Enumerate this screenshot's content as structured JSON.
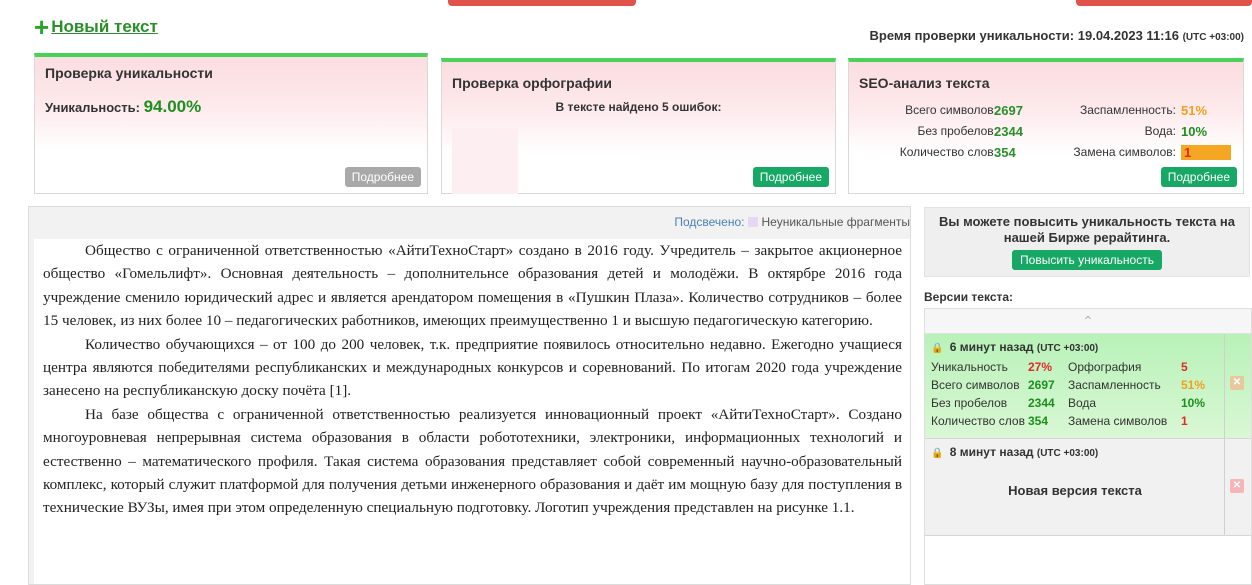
{
  "header": {
    "new_text_label": "Новый текст",
    "check_time_label": "Время проверки уникальности:",
    "check_time_value": "19.04.2023 11:16",
    "check_time_tz": "(UTC +03:00)"
  },
  "uniqueness": {
    "title": "Проверка уникальности",
    "label": "Уникальность:",
    "value": "94.00%",
    "more": "Подробнее"
  },
  "spelling": {
    "title": "Проверка орфографии",
    "errors_text": "В тексте найдено 5 ошибок:",
    "more": "Подробнее"
  },
  "seo": {
    "title": "SEO-анализ текста",
    "rows": [
      {
        "label1": "Всего символов:",
        "value1": "2697",
        "label2": "Заспамленность:",
        "value2": "51%"
      },
      {
        "label1": "Без пробелов:",
        "value1": "2344",
        "label2": "Вода:",
        "value2": "10%"
      },
      {
        "label1": "Количество слов:",
        "value1": "354",
        "label2": "Замена символов:",
        "value2": "1"
      }
    ],
    "more": "Подробнее"
  },
  "legend": {
    "label": "Подсвечено:",
    "text": "Неуникальные фрагменты"
  },
  "document": {
    "paragraphs": [
      "Общество с ограниченной ответственностью «АйтиТехноСтарт» создано в 2016 году. Учредитель – закрытое акционерное общество «Гомельлифт». Основная деятельность – дополнительнсе образования детей и молодёжи. В октярбре 2016 года учреждение сменило юридический адрес и является арендатором помещения в «Пушкин Плаза». Количество сотрудников – более 15 человек, из них более 10 – педагогических работников, имеющих преимущественно 1 и высшую педагогическую категорию.",
      "Количество обучающихся – от 100 до 200 человек, т.к. предприятие появилось относительно недавно. Ежегодно учащиеся центра являются победителями республиканских и международных конкурсов и соревнований. По итогам 2020 года учреждение занесено на республиканскую доску почёта [1].",
      "На базе общества с ограниченной ответственностью реализуется инновационный проект «АйтиТехноСтарт». Создано многоуровневая непрерывная система образования в области робототехники, электроники, информационных технологий и естественно – математического профиля. Такая система образования представляет собой современный научно-образовательный комплекс, который служит платформой для получения детьми инженерного образования и даёт им мощную базу для поступления в технические ВУЗы, имея при этом определенную специальную подготовку. Логотип учреждения представлен на рисунке 1.1."
    ]
  },
  "promo": {
    "text": "Вы можете повысить уникальность текста на нашей Бирже рерайтинга.",
    "button": "Повысить уникальность"
  },
  "versions": {
    "title": "Версии текста:",
    "items": [
      {
        "time": "6 минут назад",
        "tz": "(UTC +03:00)",
        "rows": [
          {
            "label1": "Уникальность",
            "value1": "27%",
            "label2": "Орфография",
            "value2": "5"
          },
          {
            "label1": "Всего символов",
            "value1": "2697",
            "label2": "Заспамленность",
            "value2": "51%"
          },
          {
            "label1": "Без пробелов",
            "value1": "2344",
            "label2": "Вода",
            "value2": "10%"
          },
          {
            "label1": "Количество слов",
            "value1": "354",
            "label2": "Замена символов",
            "value2": "1"
          }
        ]
      },
      {
        "time": "8 минут назад",
        "tz": "(UTC +03:00)",
        "new_version": "Новая версия текста"
      }
    ]
  },
  "colors": {
    "accent_green": "#16a864",
    "card_top": "#49d25a",
    "warning_red": "#e02a2a",
    "warning_orange": "#f0a020"
  }
}
